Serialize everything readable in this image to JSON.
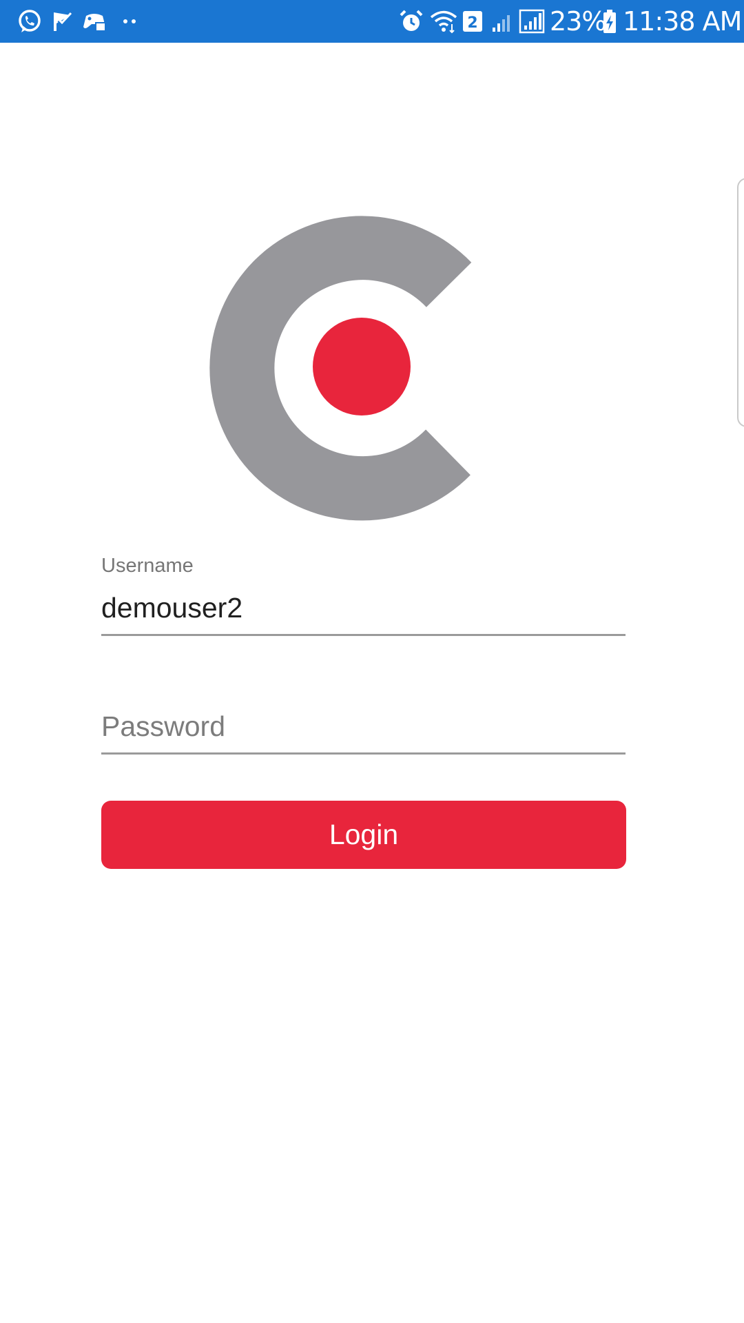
{
  "status_bar": {
    "battery_percent": "23%",
    "time": "11:38 AM",
    "sim_slot": "2",
    "left_icons": [
      "whatsapp-icon",
      "check-flag-icon",
      "game-controller-icon",
      "more-notifications-icon"
    ],
    "right_icons": [
      "alarm-icon",
      "wifi-icon",
      "sim-2-icon",
      "signal-icon",
      "signal-icon",
      "battery-charging-icon"
    ]
  },
  "logo": {
    "icon": "brand-logo-icon",
    "colors": {
      "ring": "#97979b",
      "dot": "#e8253c"
    }
  },
  "form": {
    "username": {
      "label": "Username",
      "value": "demouser2",
      "placeholder": ""
    },
    "password": {
      "label": "",
      "value": "",
      "placeholder": "Password"
    },
    "login_label": "Login"
  },
  "colors": {
    "status_bar": "#1a76d2",
    "accent": "#e8253c",
    "underline": "#9a9a9a",
    "label": "#767676"
  }
}
